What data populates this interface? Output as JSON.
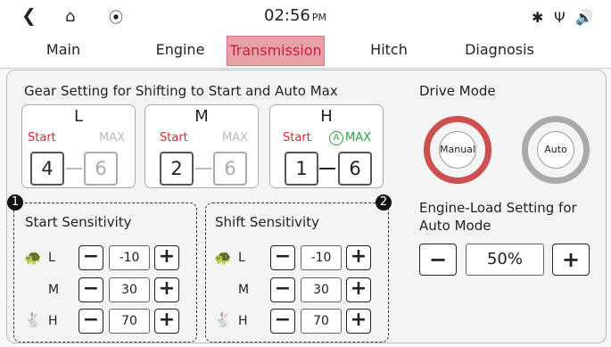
{
  "status_bar": {
    "back_icon": "back-chevron-icon",
    "home_icon": "home-icon",
    "signal_icon": "broadcast-icon",
    "time": "02:56",
    "meridiem": "PM",
    "bluetooth_icon": "bluetooth-icon",
    "usb_icon": "usb-icon",
    "volume_icon": "volume-icon"
  },
  "tabs": [
    "Main",
    "Engine",
    "Transmission",
    "Hitch",
    "Diagnosis"
  ],
  "active_tab": "Transmission",
  "gear_section": {
    "title": "Gear Setting for Shifting to Start and Auto Max",
    "cards": [
      {
        "gear": "L",
        "start_label": "Start",
        "max_label": "MAX",
        "start_value": "4",
        "max_value": "6",
        "max_active": false
      },
      {
        "gear": "M",
        "start_label": "Start",
        "max_label": "MAX",
        "start_value": "2",
        "max_value": "6",
        "max_active": false
      },
      {
        "gear": "H",
        "start_label": "Start",
        "max_label": "MAX",
        "start_value": "1",
        "max_value": "6",
        "max_active": true
      }
    ]
  },
  "start_sensitivity": {
    "badge": "1",
    "title": "Start Sensitivity",
    "rows": [
      {
        "label": "L",
        "icon": "turtle-icon",
        "value": "-10"
      },
      {
        "label": "M",
        "icon": "",
        "value": "30"
      },
      {
        "label": "H",
        "icon": "rabbit-icon",
        "value": "70"
      }
    ]
  },
  "shift_sensitivity": {
    "badge": "2",
    "title": "Shift Sensitivity",
    "rows": [
      {
        "label": "L",
        "icon": "turtle-icon",
        "value": "-10"
      },
      {
        "label": "M",
        "icon": "",
        "value": "30"
      },
      {
        "label": "H",
        "icon": "rabbit-icon",
        "value": "70"
      }
    ]
  },
  "drive_mode": {
    "title": "Drive Mode",
    "manual_label": "Manual",
    "auto_label": "Auto",
    "manual_color": "#cd5050",
    "auto_color": "#aaaaaa"
  },
  "engine_load": {
    "title_line1": "Engine-Load Setting for",
    "title_line2": "Auto Mode",
    "value": "50%"
  },
  "buttons": {
    "minus": "−",
    "plus": "+"
  }
}
